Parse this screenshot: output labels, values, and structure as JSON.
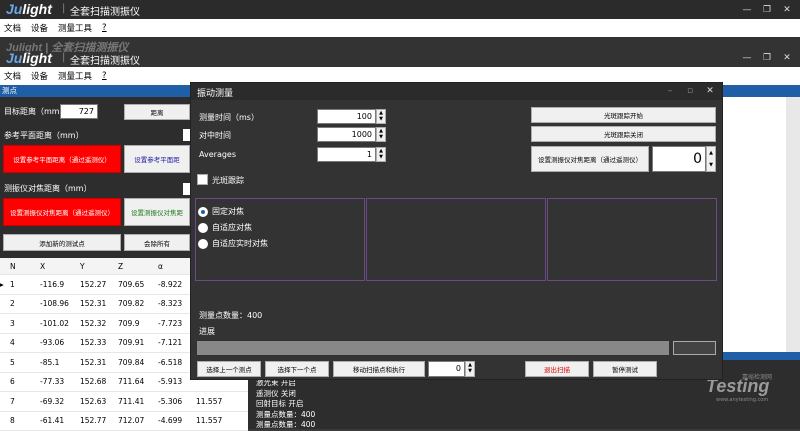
{
  "back_window": {
    "title": "全套扫描测振仪",
    "logo_prefix": "Ju",
    "logo_suffix": "light",
    "menu": [
      "文档",
      "设备",
      "测量工具",
      "?"
    ]
  },
  "main_window": {
    "title": "全套扫描测振仪",
    "logo_prefix": "Ju",
    "logo_suffix": "light",
    "menu": [
      "文档",
      "设备",
      "测量工具",
      "?"
    ],
    "side_title": "测点",
    "target_distance_label": "目标距离（mm）",
    "target_distance_value": "727",
    "distance_button": "距离",
    "ref_plane_label": "参考平面距离（mm）",
    "ref_plane_set_button": "设置参考平面距离（通过遥测仪）",
    "ref_plane_set_button2": "设置参考平面距",
    "focus_distance_label": "测振仪对焦距离（mm）",
    "focus_set_button": "设置测振仪对焦距离（通过遥测仪）",
    "focus_set_button2": "设置测振仪对焦距",
    "add_point_button": "添加新的测试点",
    "delete_all_button": "会除所有",
    "table": {
      "headers": [
        "N",
        "X",
        "Y",
        "Z",
        "α",
        ""
      ],
      "rows": [
        [
          "1",
          "-116.9",
          "152.27",
          "709.65",
          "-8.922",
          ""
        ],
        [
          "2",
          "-108.96",
          "152.31",
          "709.82",
          "-8.323",
          ""
        ],
        [
          "3",
          "-101.02",
          "152.32",
          "709.9",
          "-7.723",
          ""
        ],
        [
          "4",
          "-93.06",
          "152.33",
          "709.91",
          "-7.121",
          ""
        ],
        [
          "5",
          "-85.1",
          "152.31",
          "709.84",
          "-6.518",
          ""
        ],
        [
          "6",
          "-77.33",
          "152.68",
          "711.64",
          "-5.913",
          ""
        ],
        [
          "7",
          "-69.32",
          "152.63",
          "711.41",
          "-5.306",
          "11.557"
        ],
        [
          "8",
          "-61.41",
          "152.77",
          "712.07",
          "-4.699",
          "11.557"
        ]
      ]
    },
    "log": [
      "激光束 开启",
      "遥测仪 关闭",
      "回射目标 开启",
      "测量点数量：400",
      "测量点数量：400"
    ],
    "watermark": "Testing",
    "watermark_sub": "嘉峪检测网",
    "watermark_url": "www.anytesting.com"
  },
  "dialog": {
    "title": "振动测量",
    "measure_time_label": "测量时间（ms）",
    "measure_time_value": "100",
    "pair_time_label": "对中时间",
    "pair_time_value": "1000",
    "averages_label": "Averages",
    "averages_value": "1",
    "spot_on_button": "光斑跟踪开始",
    "spot_off_button": "光斑跟踪关闭",
    "set_focus_button": "设置测振仪对焦距离（通过遥测仪）",
    "focus_value": "0",
    "spot_tracking_checkbox": "光斑跟踪",
    "focus_options": [
      "固定对焦",
      "自适应对焦",
      "自适应实时对焦"
    ],
    "point_count": "测量点数量：400",
    "progress_label": "进展",
    "progress_fraction": 0,
    "prev_button": "选择上一个测点",
    "next_button": "选择下一个点",
    "move_button": "移动扫描点和执行",
    "step_value": "0",
    "exit_button": "退出扫描",
    "pause_button": "暂停测试"
  }
}
